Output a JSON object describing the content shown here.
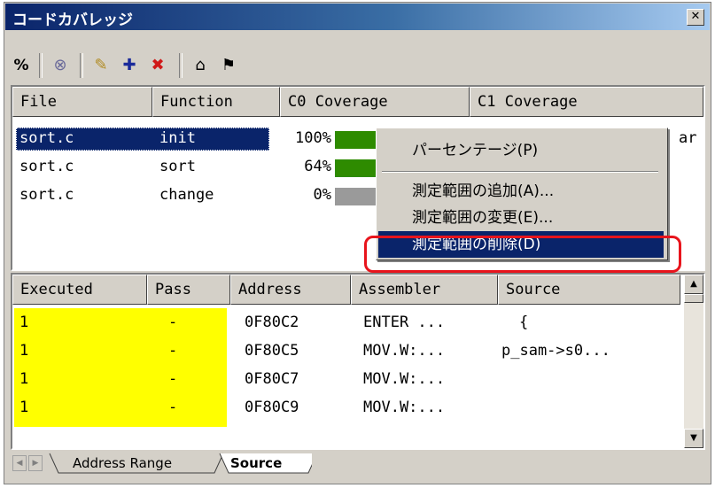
{
  "window": {
    "title": "コードカバレッジ",
    "close_glyph": "✕"
  },
  "toolbar": {
    "buttons": [
      "%",
      "⊗",
      "✎",
      "✚",
      "✖",
      "⌂",
      "⚑"
    ]
  },
  "top_table": {
    "columns": [
      "File",
      "Function",
      "C0 Coverage",
      "C1 Coverage"
    ],
    "rows": [
      {
        "file": "sort.c",
        "function": "init",
        "c0": "100%",
        "c0_fraction": 1.0
      },
      {
        "file": "sort.c",
        "function": "sort",
        "c0": "64%",
        "c0_fraction": 0.64
      },
      {
        "file": "sort.c",
        "function": "change",
        "c0": "0%",
        "c0_fraction": 0.0
      }
    ],
    "clipped_right_text": "ar"
  },
  "context_menu": {
    "items": [
      "パーセンテージ(P)",
      "測定範囲の追加(A)...",
      "測定範囲の変更(E)...",
      "測定範囲の削除(D)"
    ],
    "highlighted_index": 3
  },
  "bottom_table": {
    "columns": [
      "Executed",
      "Pass",
      "Address",
      "Assembler",
      "Source"
    ],
    "rows": [
      {
        "executed": "1",
        "pass": "-",
        "address": "0F80C2",
        "assembler": "ENTER ...",
        "source": "{"
      },
      {
        "executed": "1",
        "pass": "-",
        "address": "0F80C5",
        "assembler": "MOV.W:...",
        "source": "p_sam->s0..."
      },
      {
        "executed": "1",
        "pass": "-",
        "address": "0F80C7",
        "assembler": "MOV.W:...",
        "source": ""
      },
      {
        "executed": "1",
        "pass": "-",
        "address": "0F80C9",
        "assembler": "MOV.W:...",
        "source": ""
      }
    ]
  },
  "tabs": [
    "Address Range",
    "Source"
  ],
  "active_tab": "Source",
  "colors": {
    "selection": "#0a246a",
    "coverage_bar": "#2e8b00",
    "executed_highlight": "#ffff00",
    "annotation": "#e8141c"
  }
}
